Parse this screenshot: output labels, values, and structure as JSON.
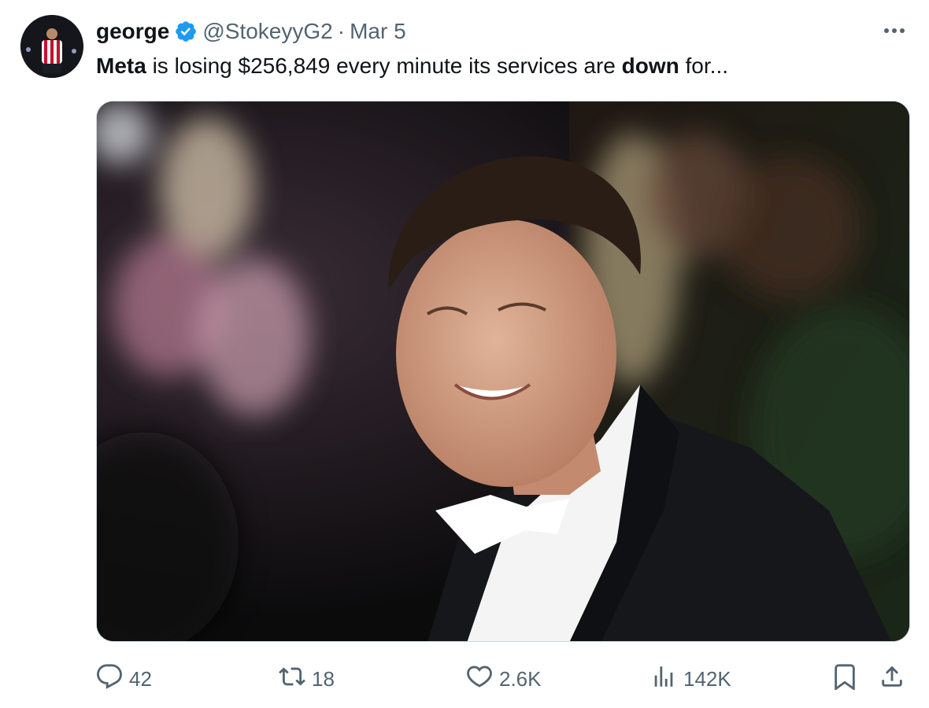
{
  "tweet": {
    "author": {
      "display_name": "george",
      "handle": "@StokeyyG2",
      "verified": true
    },
    "separator": "·",
    "date": "Mar 5",
    "text": {
      "part1_bold": "Meta",
      "part2": " is losing $256,849 every minute its services are ",
      "part3_bold": "down",
      "part4": " for..."
    },
    "media": {
      "kind": "photo"
    },
    "stats": {
      "replies": "42",
      "reposts": "18",
      "likes": "2.6K",
      "views": "142K"
    }
  },
  "icons": {
    "more": "more-icon",
    "verified": "verified-badge-icon",
    "reply": "reply-icon",
    "repost": "repost-icon",
    "like": "like-icon",
    "views": "views-icon",
    "bookmark": "bookmark-icon",
    "share": "share-icon"
  },
  "colors": {
    "text_primary": "#0f1419",
    "text_secondary": "#536471",
    "verified_blue": "#1d9bf0",
    "border": "#cfd9de"
  }
}
